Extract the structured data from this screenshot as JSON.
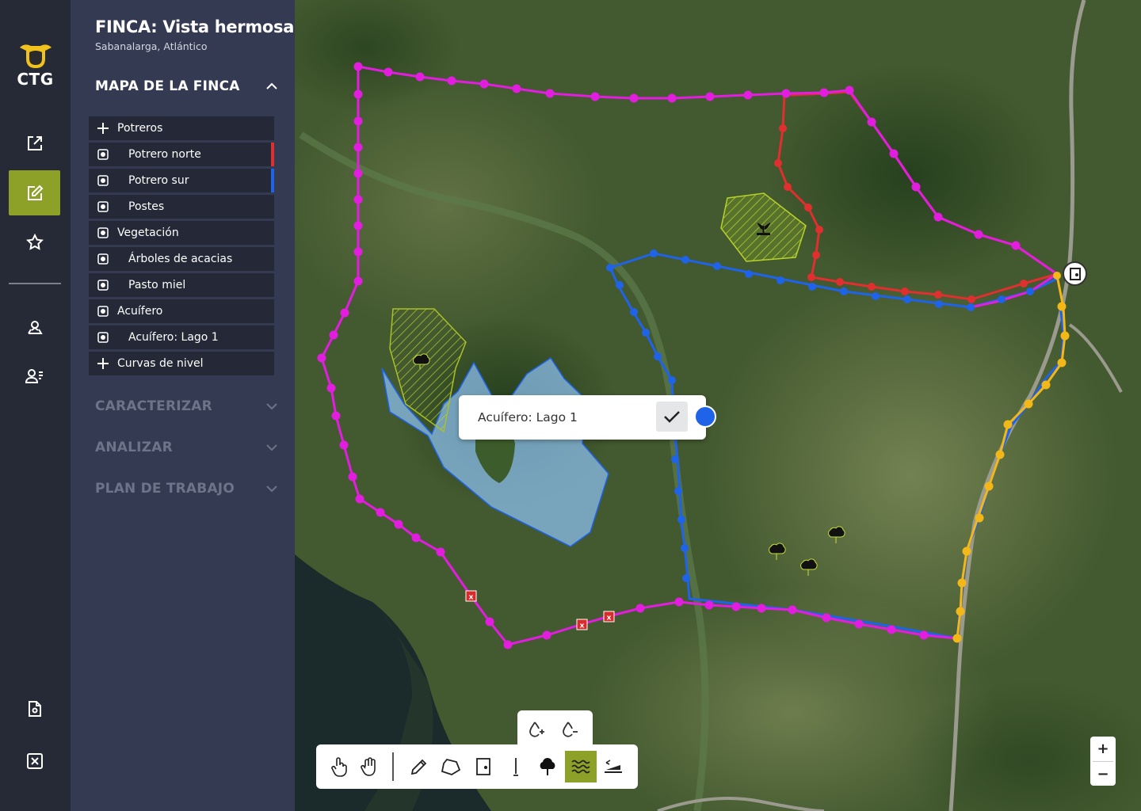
{
  "app": {
    "logo_text": "CTG"
  },
  "rail": {
    "items": [
      {
        "name": "export",
        "icon": "external-link-icon"
      },
      {
        "name": "edit",
        "icon": "edit-icon",
        "active": true
      },
      {
        "name": "favorites",
        "icon": "star-icon"
      },
      {
        "name": "field-visits",
        "icon": "map-pin-icon"
      },
      {
        "name": "users",
        "icon": "users-icon"
      },
      {
        "name": "report-settings",
        "icon": "file-settings-icon"
      },
      {
        "name": "close",
        "icon": "close-box-icon"
      }
    ]
  },
  "farm": {
    "title": "FINCA: Vista hermosa",
    "location": "Sabanalarga, Atlántico"
  },
  "sections": {
    "map": "MAPA DE LA FINCA",
    "characterize": "CARACTERIZAR",
    "analyze": "ANALIZAR",
    "work_plan": "PLAN DE TRABAJO"
  },
  "layers": [
    {
      "label": "Potreros",
      "kind": "group-add",
      "icon": "plus-icon"
    },
    {
      "label": "Potrero norte",
      "kind": "child",
      "icon": "radio-icon",
      "color": "#e02f2f"
    },
    {
      "label": "Potrero sur",
      "kind": "child",
      "icon": "radio-icon",
      "color": "#1f63e8"
    },
    {
      "label": "Postes",
      "kind": "child",
      "icon": "radio-icon"
    },
    {
      "label": "Vegetación",
      "kind": "group",
      "icon": "radio-icon"
    },
    {
      "label": "Árboles de acacias",
      "kind": "child",
      "icon": "radio-icon"
    },
    {
      "label": "Pasto miel",
      "kind": "child",
      "icon": "radio-icon"
    },
    {
      "label": "Acuífero",
      "kind": "group",
      "icon": "radio-icon"
    },
    {
      "label": "Acuífero: Lago 1",
      "kind": "child",
      "icon": "radio-icon"
    },
    {
      "label": "Curvas de nivel",
      "kind": "group-add",
      "icon": "plus-icon"
    }
  ],
  "popup": {
    "label": "Acuífero: Lago 1",
    "confirm_icon": "check-icon",
    "color": "#1f63e8"
  },
  "subtools": [
    {
      "name": "add-water-point",
      "icon": "drop-plus-icon",
      "active": true
    },
    {
      "name": "remove-water-point",
      "icon": "drop-minus-icon"
    }
  ],
  "toolbar": [
    {
      "name": "select",
      "icon": "pointer-hand-icon"
    },
    {
      "name": "pan",
      "icon": "hand-icon"
    },
    {
      "name": "draw-line",
      "icon": "pencil-icon"
    },
    {
      "name": "draw-polygon",
      "icon": "polygon-icon"
    },
    {
      "name": "gate",
      "icon": "door-icon"
    },
    {
      "name": "post",
      "icon": "post-icon"
    },
    {
      "name": "tree",
      "icon": "tree-icon"
    },
    {
      "name": "water",
      "icon": "water-waves-icon",
      "active": true
    },
    {
      "name": "slope",
      "icon": "slope-icon"
    }
  ],
  "zoom": {
    "in": "+",
    "out": "−"
  },
  "colors": {
    "accent": "#8da027",
    "boundary": "#e21de0",
    "potrero_norte": "#e02f2f",
    "potrero_sur": "#1f63e8",
    "road_fence": "#f3b818",
    "water": "#8ec2f2"
  }
}
